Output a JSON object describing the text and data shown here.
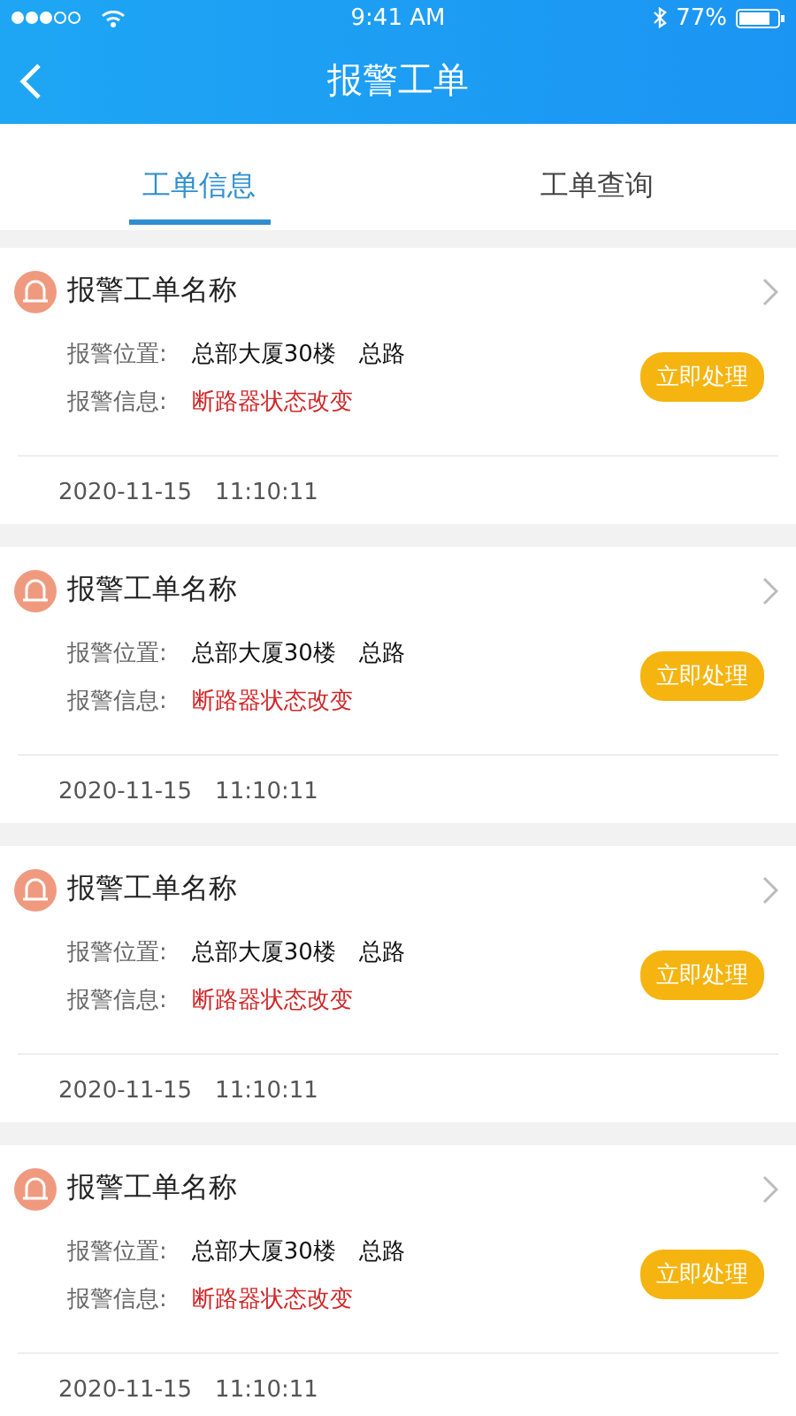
{
  "status_bar": {
    "time": "9:41 AM",
    "battery": "77%"
  },
  "nav": {
    "title": "报警工单"
  },
  "tabs": [
    {
      "label": "工单信息",
      "selected": true
    },
    {
      "label": "工单查询",
      "selected": false
    }
  ],
  "orders": [
    {
      "title": "报警工单名称",
      "location_label": "报警位置:",
      "location": "总部大厦30楼　总路",
      "info_label": "报警信息:",
      "info": "断路器状态改变",
      "action": "立即处理",
      "time": "2020-11-15　11:10:11"
    },
    {
      "title": "报警工单名称",
      "location_label": "报警位置:",
      "location": "总部大厦30楼　总路",
      "info_label": "报警信息:",
      "info": "断路器状态改变",
      "action": "立即处理",
      "time": "2020-11-15　11:10:11"
    },
    {
      "title": "报警工单名称",
      "location_label": "报警位置:",
      "location": "总部大厦30楼　总路",
      "info_label": "报警信息:",
      "info": "断路器状态改变",
      "action": "立即处理",
      "time": "2020-11-15　11:10:11"
    },
    {
      "title": "报警工单名称",
      "location_label": "报警位置:",
      "location": "总部大厦30楼　总路",
      "info_label": "报警信息:",
      "info": "断路器状态改变",
      "action": "立即处理",
      "time": "2020-11-15　11:10:11"
    }
  ]
}
